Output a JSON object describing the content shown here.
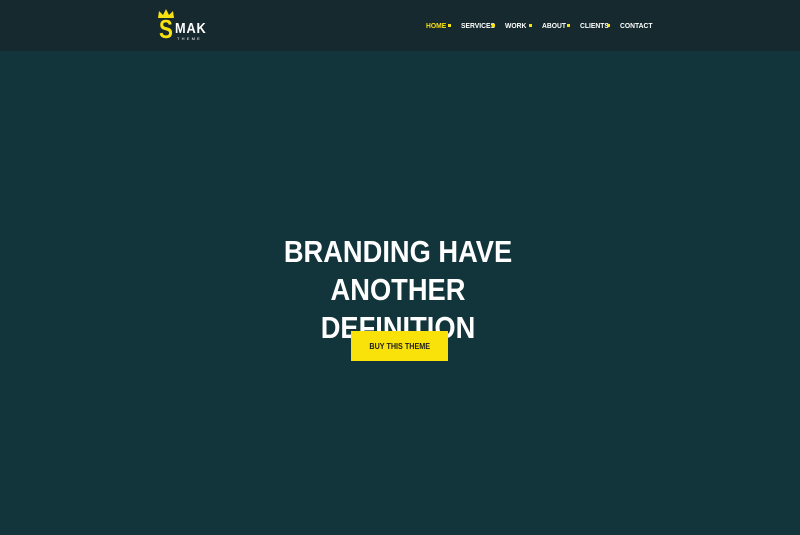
{
  "brand": {
    "letter": "S",
    "name": "MAK",
    "tagline": "THEME",
    "accent_color": "#f7e10e",
    "icon": "crown-icon"
  },
  "nav": {
    "items": [
      {
        "label": "HOME",
        "active": true
      },
      {
        "label": "SERVICES",
        "active": false
      },
      {
        "label": "WORK",
        "active": false
      },
      {
        "label": "ABOUT",
        "active": false
      },
      {
        "label": "CLIENTS",
        "active": false
      },
      {
        "label": "CONTACT",
        "active": false
      }
    ],
    "separator_color": "#f7e10e"
  },
  "hero": {
    "title_line1": "BRANDING HAVE ANOTHER",
    "title_line2": "DEFINITION",
    "cta_label": "BUY THIS THEME",
    "background_color": "#12353b"
  }
}
